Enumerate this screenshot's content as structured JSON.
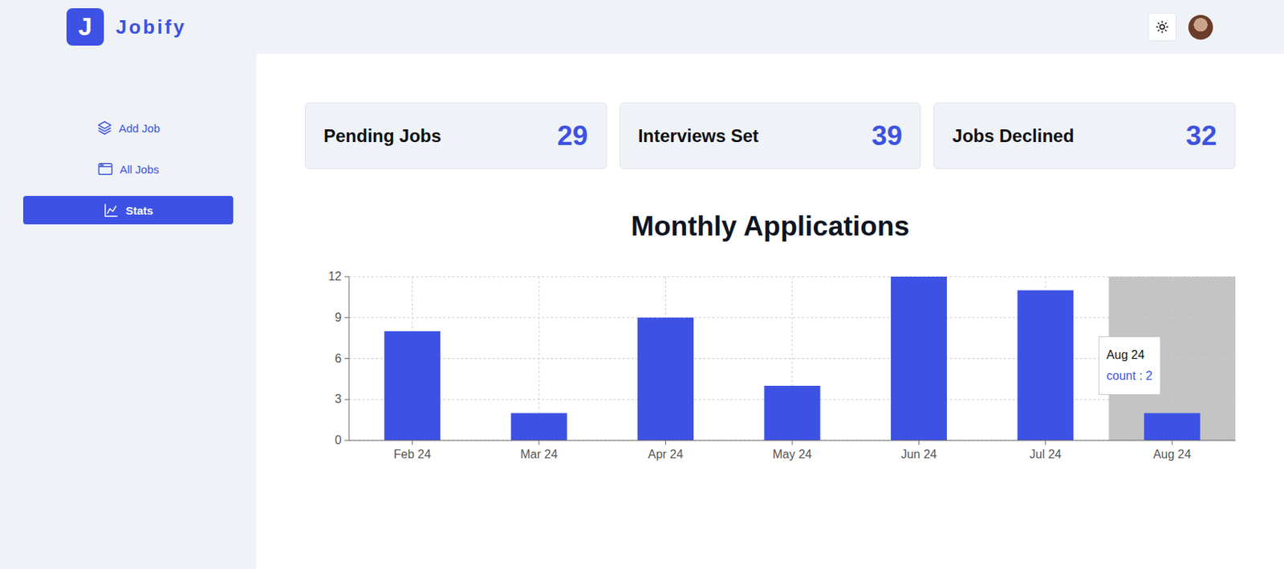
{
  "logo": {
    "letter": "J",
    "name": "Jobify"
  },
  "sidebar": {
    "items": [
      {
        "label": "Add Job",
        "icon": "layers",
        "selected": false
      },
      {
        "label": "All Jobs",
        "icon": "window",
        "selected": false
      },
      {
        "label": "Stats",
        "icon": "chart",
        "selected": true
      }
    ]
  },
  "stats": [
    {
      "label": "Pending Jobs",
      "value": "29"
    },
    {
      "label": "Interviews Set",
      "value": "39"
    },
    {
      "label": "Jobs Declined",
      "value": "32"
    }
  ],
  "chart": {
    "title": "Monthly Applications",
    "y_max": 12,
    "y_ticks": [
      "0",
      "3",
      "6",
      "9",
      "12"
    ],
    "categories": [
      {
        "label": "Feb 24",
        "hovered": false
      },
      {
        "label": "Mar 24",
        "hovered": false
      },
      {
        "label": "Apr 24",
        "hovered": false
      },
      {
        "label": "May 24",
        "hovered": false
      },
      {
        "label": "Jun 24",
        "hovered": false
      },
      {
        "label": "Jul 24",
        "hovered": false
      },
      {
        "label": "Aug 24",
        "hovered": true
      }
    ],
    "series": [
      {
        "name": "count",
        "values": [
          8,
          2,
          9,
          4,
          12,
          11,
          2
        ]
      }
    ],
    "tooltip": {
      "title": "Aug 24",
      "text": "count : 2"
    }
  }
}
